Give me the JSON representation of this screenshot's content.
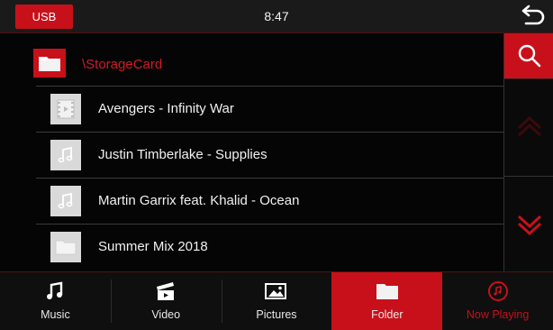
{
  "status_bar": {
    "source_badge": "USB",
    "time": "8:47"
  },
  "browser": {
    "path": "\\StorageCard",
    "items": [
      {
        "name": "Avengers - Infinity War",
        "icon": "video-file-icon"
      },
      {
        "name": "Justin Timberlake - Supplies",
        "icon": "music-file-icon"
      },
      {
        "name": "Martin Garrix feat. Khalid - Ocean",
        "icon": "music-file-icon"
      },
      {
        "name": "Summer Mix 2018",
        "icon": "folder-icon"
      }
    ]
  },
  "tabs": [
    {
      "label": "Music",
      "icon": "music-note-icon"
    },
    {
      "label": "Video",
      "icon": "clapperboard-icon"
    },
    {
      "label": "Pictures",
      "icon": "picture-icon"
    },
    {
      "label": "Folder",
      "icon": "folder-icon",
      "active": true
    },
    {
      "label": "Now Playing",
      "icon": "now-playing-icon"
    }
  ],
  "colors": {
    "accent": "#c8101a",
    "background": "#050505",
    "text": "#f0f0f0"
  }
}
